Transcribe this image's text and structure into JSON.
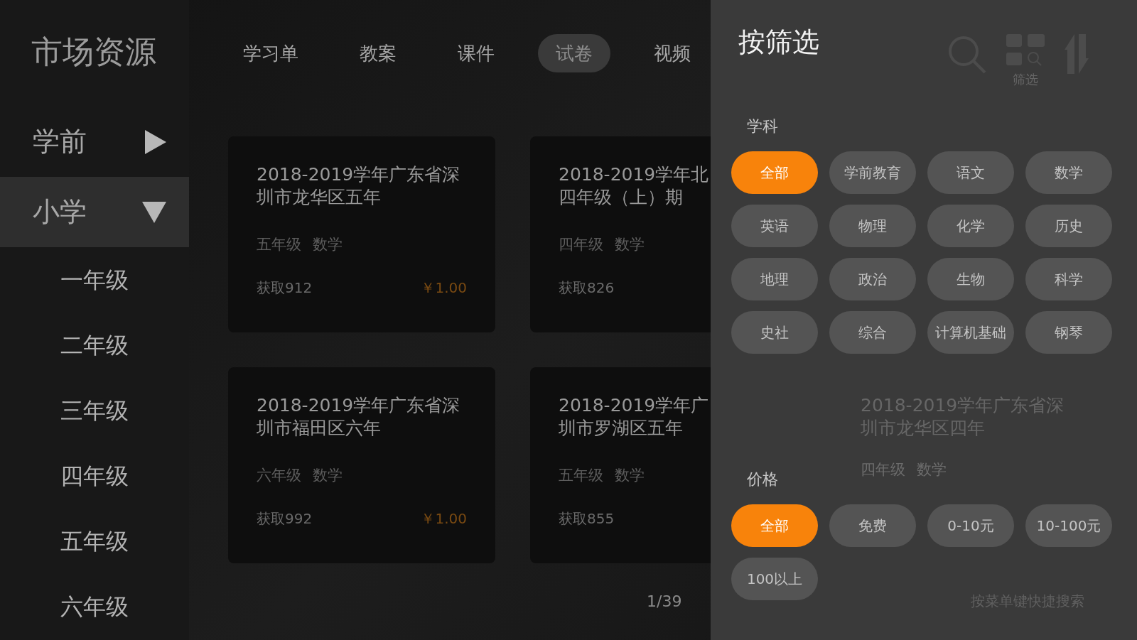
{
  "sidebar": {
    "title": "市场资源",
    "items": [
      {
        "label": "学前",
        "expanded": false,
        "selected": false
      },
      {
        "label": "小学",
        "expanded": true,
        "selected": true,
        "children": [
          {
            "label": "一年级"
          },
          {
            "label": "二年级"
          },
          {
            "label": "三年级"
          },
          {
            "label": "四年级"
          },
          {
            "label": "五年级"
          },
          {
            "label": "六年级"
          }
        ]
      }
    ]
  },
  "tabs": [
    {
      "label": "学习单",
      "selected": false
    },
    {
      "label": "教案",
      "selected": false
    },
    {
      "label": "课件",
      "selected": false
    },
    {
      "label": "试卷",
      "selected": true
    },
    {
      "label": "视频",
      "selected": false
    }
  ],
  "toolbar": {
    "filter_label": "筛选"
  },
  "cards": [
    {
      "title_lines": [
        "2018-2019学年广东省深",
        "圳市龙华区五年"
      ],
      "meta": [
        "五年级",
        "数学"
      ],
      "count": "获取912",
      "price": "￥1.00"
    },
    {
      "title_lines": [
        "2018-2019学年北",
        "四年级（上）期"
      ],
      "meta": [
        "四年级",
        "数学"
      ],
      "count": "获取826"
    },
    {
      "title_lines": [
        "2018-2019学年广东省深",
        "圳市福田区六年"
      ],
      "meta": [
        "六年级",
        "数学"
      ],
      "count": "获取992",
      "price": "￥1.00"
    },
    {
      "title_lines": [
        "2018-2019学年广",
        "圳市罗湖区五年"
      ],
      "meta": [
        "五年级",
        "数学"
      ],
      "count": "获取855"
    }
  ],
  "hidden_card": {
    "title_lines": [
      "2018-2019学年广东省深",
      "圳市龙华区四年"
    ],
    "meta": [
      "四年级",
      "数学"
    ]
  },
  "pagination": "1/39",
  "hint": "按菜单键快捷搜索",
  "filter_panel": {
    "title": "按筛选",
    "sections": [
      {
        "label": "学科",
        "options": [
          {
            "label": "全部",
            "selected": true
          },
          {
            "label": "学前教育",
            "selected": false
          },
          {
            "label": "语文",
            "selected": false
          },
          {
            "label": "数学",
            "selected": false
          },
          {
            "label": "英语",
            "selected": false
          },
          {
            "label": "物理",
            "selected": false
          },
          {
            "label": "化学",
            "selected": false
          },
          {
            "label": "历史",
            "selected": false
          },
          {
            "label": "地理",
            "selected": false
          },
          {
            "label": "政治",
            "selected": false
          },
          {
            "label": "生物",
            "selected": false
          },
          {
            "label": "科学",
            "selected": false
          },
          {
            "label": "史社",
            "selected": false
          },
          {
            "label": "综合",
            "selected": false
          },
          {
            "label": "计算机基础",
            "selected": false
          },
          {
            "label": "钢琴",
            "selected": false
          }
        ]
      },
      {
        "label": "价格",
        "options": [
          {
            "label": "全部",
            "selected": true
          },
          {
            "label": "免费",
            "selected": false
          },
          {
            "label": "0-10元",
            "selected": false
          },
          {
            "label": "10-100元",
            "selected": false
          },
          {
            "label": "100以上",
            "selected": false
          }
        ]
      }
    ]
  }
}
